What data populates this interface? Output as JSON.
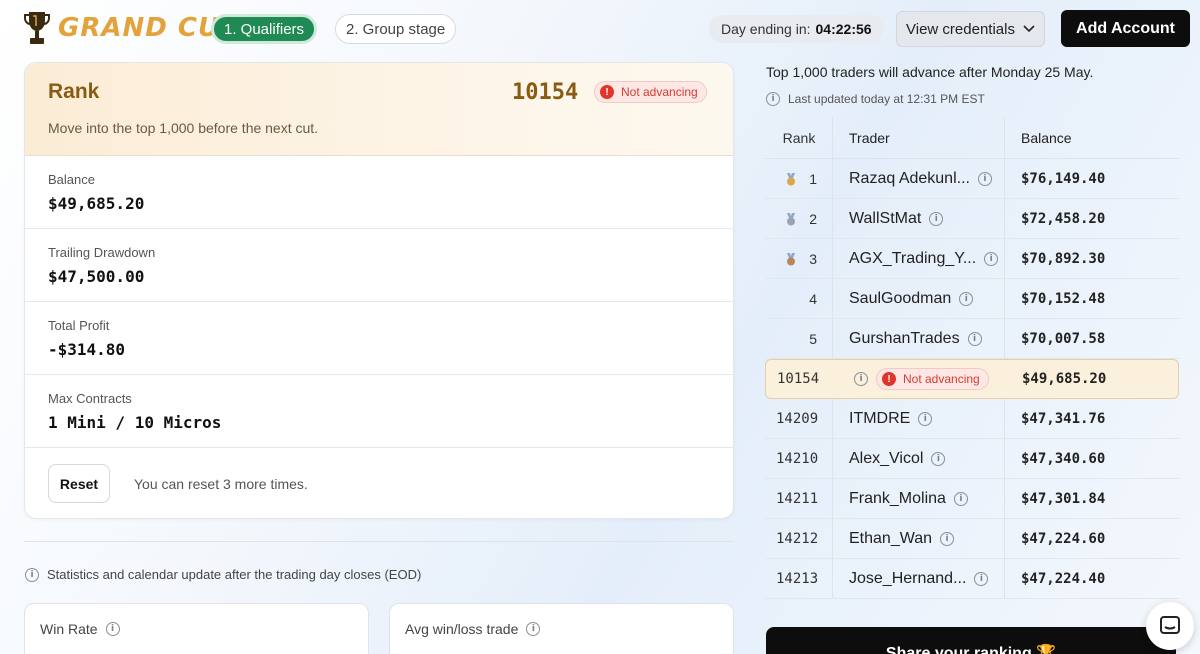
{
  "brand": {
    "name": "GRAND CUP",
    "icon": "trophy-icon"
  },
  "steps": [
    {
      "label": "1. Qualifiers"
    },
    {
      "label": "2. Group stage"
    }
  ],
  "timer": {
    "label": "Day ending in:",
    "value": "04:22:56"
  },
  "header": {
    "view_credentials": "View credentials",
    "add_account": "Add Account"
  },
  "rank_card": {
    "title": "Rank",
    "rank": "10154",
    "status": "Not advancing",
    "subtitle": "Move into the top 1,000 before the next cut.",
    "stats": [
      {
        "label": "Balance",
        "value": "$49,685.20"
      },
      {
        "label": "Trailing Drawdown",
        "value": "$47,500.00"
      },
      {
        "label": "Total Profit",
        "value": "-$314.80"
      },
      {
        "label": "Max Contracts",
        "value": "1 Mini / 10 Micros"
      }
    ],
    "reset_label": "Reset",
    "reset_note": "You can reset 3 more times."
  },
  "eod_note": "Statistics and calendar update after the trading day closes (EOD)",
  "mini_cards": [
    {
      "title": "Win Rate"
    },
    {
      "title": "Avg win/loss trade"
    }
  ],
  "leaderboard": {
    "headline": "Top 1,000 traders will advance after Monday 25 May.",
    "updated": "Last updated today at 12:31 PM EST",
    "columns": [
      "Rank",
      "Trader",
      "Balance"
    ],
    "rows": [
      {
        "rank": "1",
        "trader": "Razaq Adekunl...",
        "balance": "$76,149.40",
        "medal": "gold"
      },
      {
        "rank": "2",
        "trader": "WallStMat",
        "balance": "$72,458.20",
        "medal": "silver"
      },
      {
        "rank": "3",
        "trader": "AGX_Trading_Y...",
        "balance": "$70,892.30",
        "medal": "bronze"
      },
      {
        "rank": "4",
        "trader": "SaulGoodman",
        "balance": "$70,152.48"
      },
      {
        "rank": "5",
        "trader": "GurshanTrades",
        "balance": "$70,007.58"
      },
      {
        "rank": "10154",
        "trader": "",
        "status": "Not advancing",
        "balance": "$49,685.20",
        "me": true
      },
      {
        "rank": "14209",
        "trader": "ITMDRE",
        "balance": "$47,341.76"
      },
      {
        "rank": "14210",
        "trader": "Alex_Vicol",
        "balance": "$47,340.60"
      },
      {
        "rank": "14211",
        "trader": "Frank_Molina",
        "balance": "$47,301.84"
      },
      {
        "rank": "14212",
        "trader": "Ethan_Wan",
        "balance": "$47,224.60"
      },
      {
        "rank": "14213",
        "trader": "Jose_Hernand...",
        "balance": "$47,224.40"
      }
    ],
    "share_label": "Share your ranking 🏆"
  },
  "colors": {
    "accent_green": "#1f8a53",
    "gold": "#e3a23a",
    "danger": "#e0352b"
  }
}
